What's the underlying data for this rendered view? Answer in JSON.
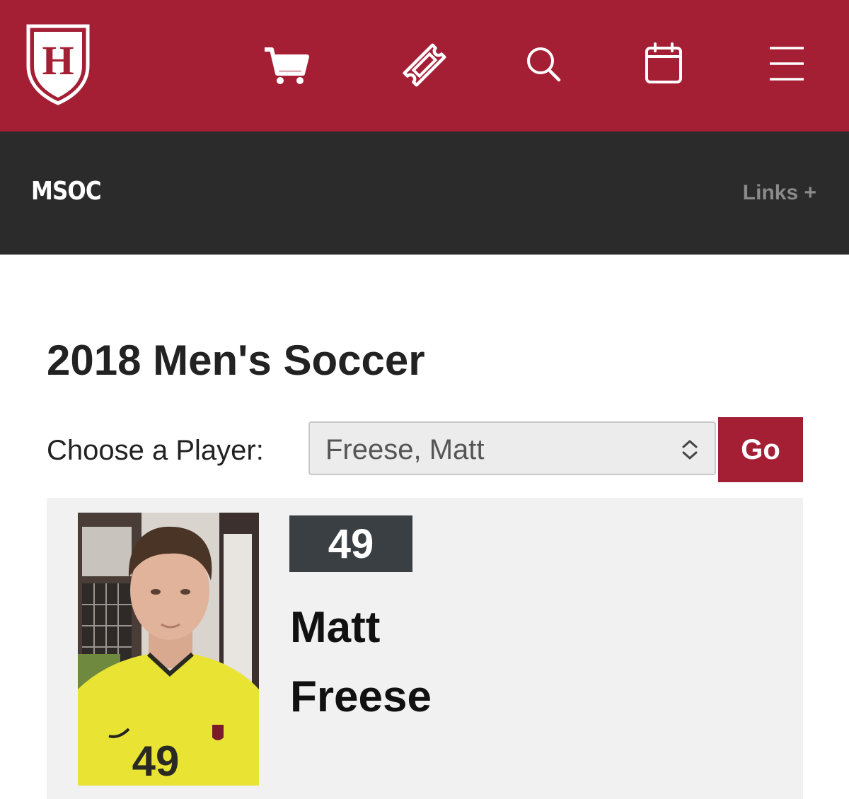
{
  "colors": {
    "brand": "#a41e34",
    "dark_bar": "#2b2b2b",
    "card_bg": "#f1f1f1",
    "badge_bg": "#3a3f44"
  },
  "header": {
    "logo_letter": "H",
    "icons": [
      "cart-icon",
      "ticket-icon",
      "search-icon",
      "calendar-icon",
      "menu-icon"
    ]
  },
  "sport_bar": {
    "code": "MSOC",
    "links_label": "Links +"
  },
  "main": {
    "title": "2018 Men's Soccer",
    "choose_label": "Choose a Player:",
    "selected_player": "Freese, Matt",
    "go_label": "Go"
  },
  "player": {
    "number": "49",
    "first_name": "Matt",
    "last_name": "Freese",
    "jersey_print": "49"
  }
}
